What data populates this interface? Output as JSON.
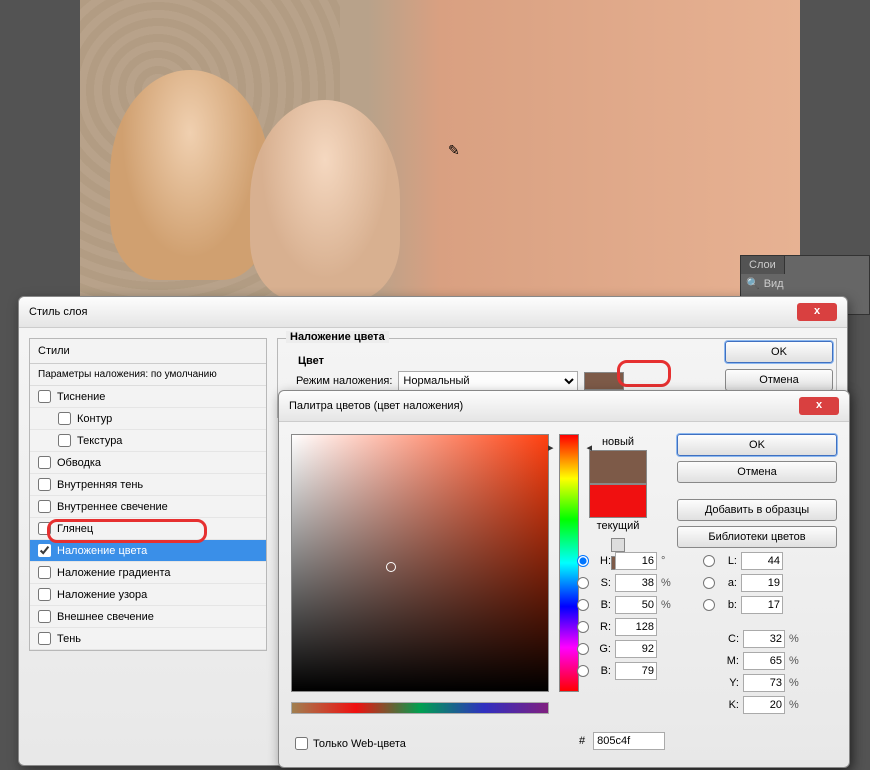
{
  "panels": {
    "tab": "Слои",
    "filter": "Вид"
  },
  "layerStyle": {
    "title": "Стиль слоя",
    "stylesHead": "Стили",
    "defaultParams": "Параметры наложения: по умолчанию",
    "items": [
      {
        "label": "Тиснение",
        "checked": false,
        "indent": false
      },
      {
        "label": "Контур",
        "checked": false,
        "indent": true
      },
      {
        "label": "Текстура",
        "checked": false,
        "indent": true
      },
      {
        "label": "Обводка",
        "checked": false,
        "indent": false
      },
      {
        "label": "Внутренняя тень",
        "checked": false,
        "indent": false
      },
      {
        "label": "Внутреннее свечение",
        "checked": false,
        "indent": false
      },
      {
        "label": "Глянец",
        "checked": false,
        "indent": false
      },
      {
        "label": "Наложение цвета",
        "checked": true,
        "indent": false,
        "selected": true
      },
      {
        "label": "Наложение градиента",
        "checked": false,
        "indent": false
      },
      {
        "label": "Наложение узора",
        "checked": false,
        "indent": false
      },
      {
        "label": "Внешнее свечение",
        "checked": false,
        "indent": false
      },
      {
        "label": "Тень",
        "checked": false,
        "indent": false
      }
    ],
    "fieldsetTitle": "Наложение цвета",
    "colorLabel": "Цвет",
    "blendModeLabel": "Режим наложения:",
    "blendMode": "Нормальный",
    "ok": "OK",
    "cancel": "Отмена"
  },
  "picker": {
    "title": "Палитра цветов (цвет наложения)",
    "newLabel": "новый",
    "currentLabel": "текущий",
    "ok": "OK",
    "cancel": "Отмена",
    "addSwatch": "Добавить в образцы",
    "libraries": "Библиотеки цветов",
    "webOnly": "Только Web-цвета",
    "hexLabel": "#",
    "hex": "805c4f",
    "H": "16",
    "S": "38",
    "B": "50",
    "R": "128",
    "G": "92",
    "Bl": "79",
    "L": "44",
    "a": "19",
    "b": "17",
    "C": "32",
    "M": "65",
    "Y": "73",
    "K": "20",
    "deg": "°",
    "pct": "%"
  }
}
